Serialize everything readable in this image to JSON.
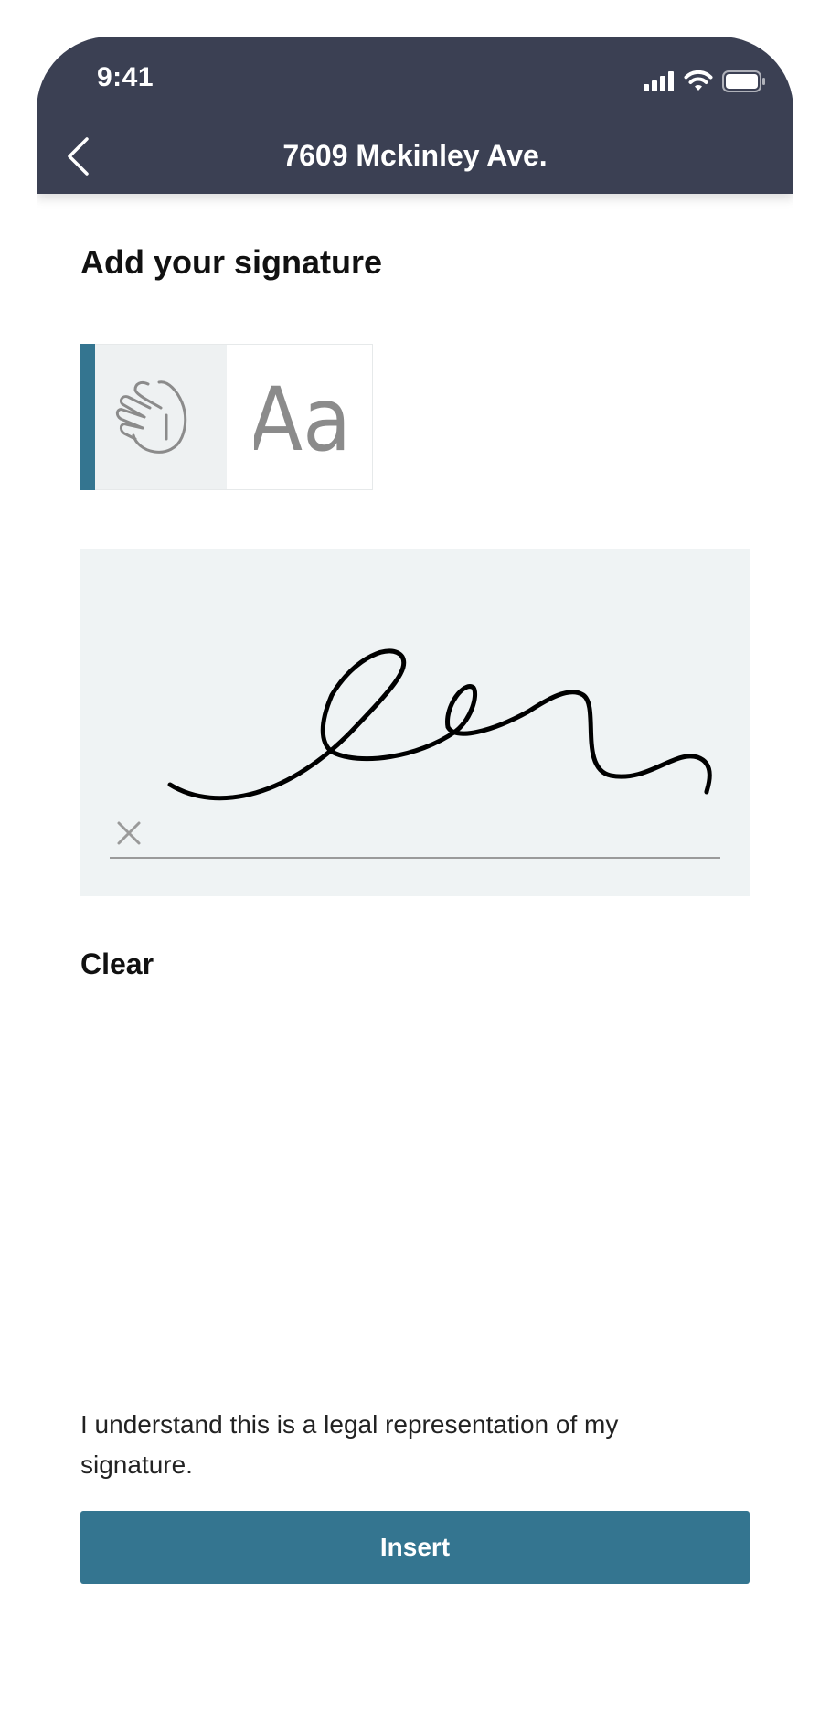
{
  "status_bar": {
    "time": "9:41"
  },
  "nav": {
    "title": "7609 Mckinley Ave.",
    "back_icon": "chevron-left-icon"
  },
  "signature": {
    "heading": "Add your signature",
    "modes": [
      {
        "name": "draw",
        "icon": "hand-pointer-icon",
        "selected": true
      },
      {
        "name": "type",
        "icon": "typography-icon",
        "label": "Aa",
        "selected": false
      }
    ],
    "clear_label": "Clear"
  },
  "legal": {
    "text": "I understand this is a legal representation of my signature."
  },
  "actions": {
    "insert_label": "Insert"
  },
  "colors": {
    "header_bg": "#3b4053",
    "accent": "#347590",
    "pad_bg": "#eff3f4"
  }
}
